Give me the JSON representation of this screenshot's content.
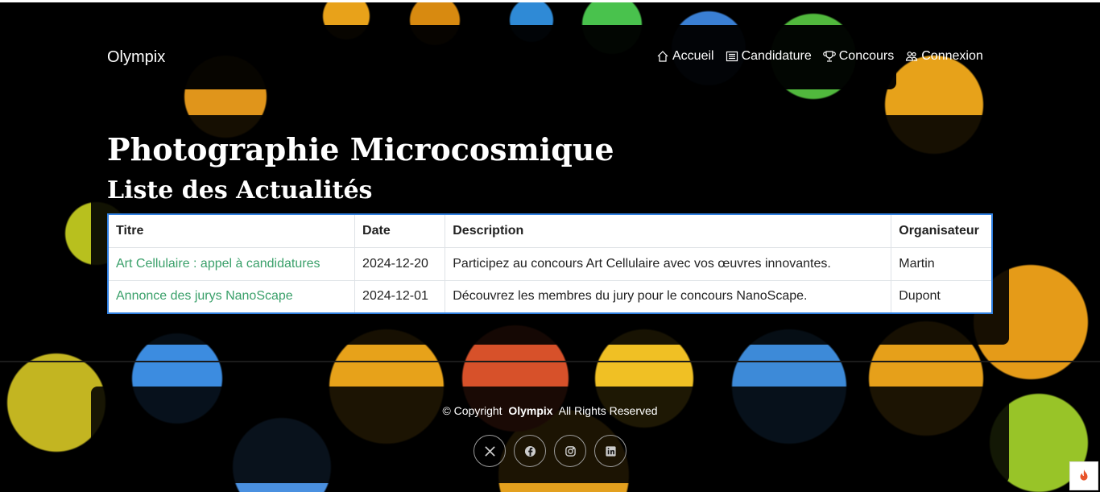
{
  "brand": "Olympix",
  "nav": {
    "items": [
      {
        "label": "Accueil",
        "icon": "home-icon"
      },
      {
        "label": "Candidature",
        "icon": "newspaper-icon"
      },
      {
        "label": "Concours",
        "icon": "trophy-icon"
      },
      {
        "label": "Connexion",
        "icon": "people-icon"
      }
    ]
  },
  "page": {
    "title": "Photographie Microcosmique",
    "subtitle": "Liste des Actualités"
  },
  "table": {
    "headers": [
      "Titre",
      "Date",
      "Description",
      "Organisateur"
    ],
    "rows": [
      {
        "title": "Art Cellulaire : appel à candidatures",
        "date": "2024-12-20",
        "description": "Participez au concours Art Cellulaire avec vos œuvres innovantes.",
        "organizer": "Martin"
      },
      {
        "title": "Annonce des jurys NanoScape",
        "date": "2024-12-01",
        "description": "Découvrez les membres du jury pour le concours NanoScape.",
        "organizer": "Dupont"
      }
    ]
  },
  "footer": {
    "copyright_prefix": "© Copyright",
    "brand": "Olympix",
    "rights": "All Rights Reserved",
    "socials": [
      "x-icon",
      "facebook-icon",
      "instagram-icon",
      "linkedin-icon"
    ]
  },
  "colors": {
    "link": "#3aa06a",
    "table_border": "#2f7fe0"
  }
}
